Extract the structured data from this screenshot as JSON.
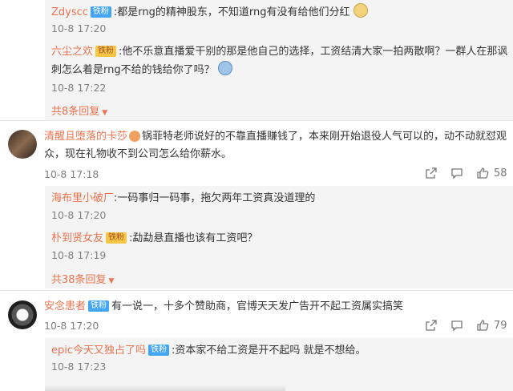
{
  "thread1": {
    "reply1": {
      "user": "Zdyscc",
      "badge": "铁粉",
      "text": ":都是rng的精神股东，不知道rng有没有给他们分红",
      "time": "10-8 17:20"
    },
    "reply2": {
      "user": "六尘之欢",
      "badge": "铁粉",
      "text_line1": ":他不乐意直播爱干别的那是他自己的选择，工资结清大家一拍两散啊？一群人在那讽",
      "text_line2": "刺怎么着是rng不给的钱给你了吗？",
      "time": "10-8 17:22"
    },
    "more_replies": "共8条回复"
  },
  "comment2": {
    "user": "清醒且堕落的卡莎",
    "text_line1": "锅菲特老师说好的不靠直播赚钱了，本来刚开始退役人气可以的，动不动就怼观",
    "text_line2": "众，现在礼物收不到公司怎么给你薪水。",
    "time": "10-8 17:18",
    "likes": "58",
    "reply1": {
      "user": "海布里小破厂",
      "text": ":一码事归一码事，拖欠两年工资真没道理的",
      "time": "10-8 17:20"
    },
    "reply2": {
      "user": "朴到贤女友",
      "badge": "铁粉",
      "text": ":勐勐悬直播也该有工资吧？",
      "time": "10-8 17:19"
    },
    "more_replies": "共38条回复"
  },
  "comment3": {
    "user": "安念患者",
    "badge": "铁粉",
    "text": "有一说一，十多个赞助商，官博天天发广告开不起工资属实搞笑",
    "time": "10-8 17:20",
    "likes": "79",
    "reply1": {
      "user": "epic今天又独占了吗",
      "badge": "铁粉",
      "text": ":资本家不给工资是开不起吗 就是不想给。",
      "time": "10-8 17:23"
    }
  },
  "colors": {
    "username": "#eb7350",
    "badge_blue": "#42a5f5",
    "badge_gold": "#f8c644",
    "reply_bg": "#f4f4f4"
  },
  "icons": [
    "share-icon",
    "comment-icon",
    "like-icon",
    "emoji-icon",
    "chevron-down-icon"
  ]
}
